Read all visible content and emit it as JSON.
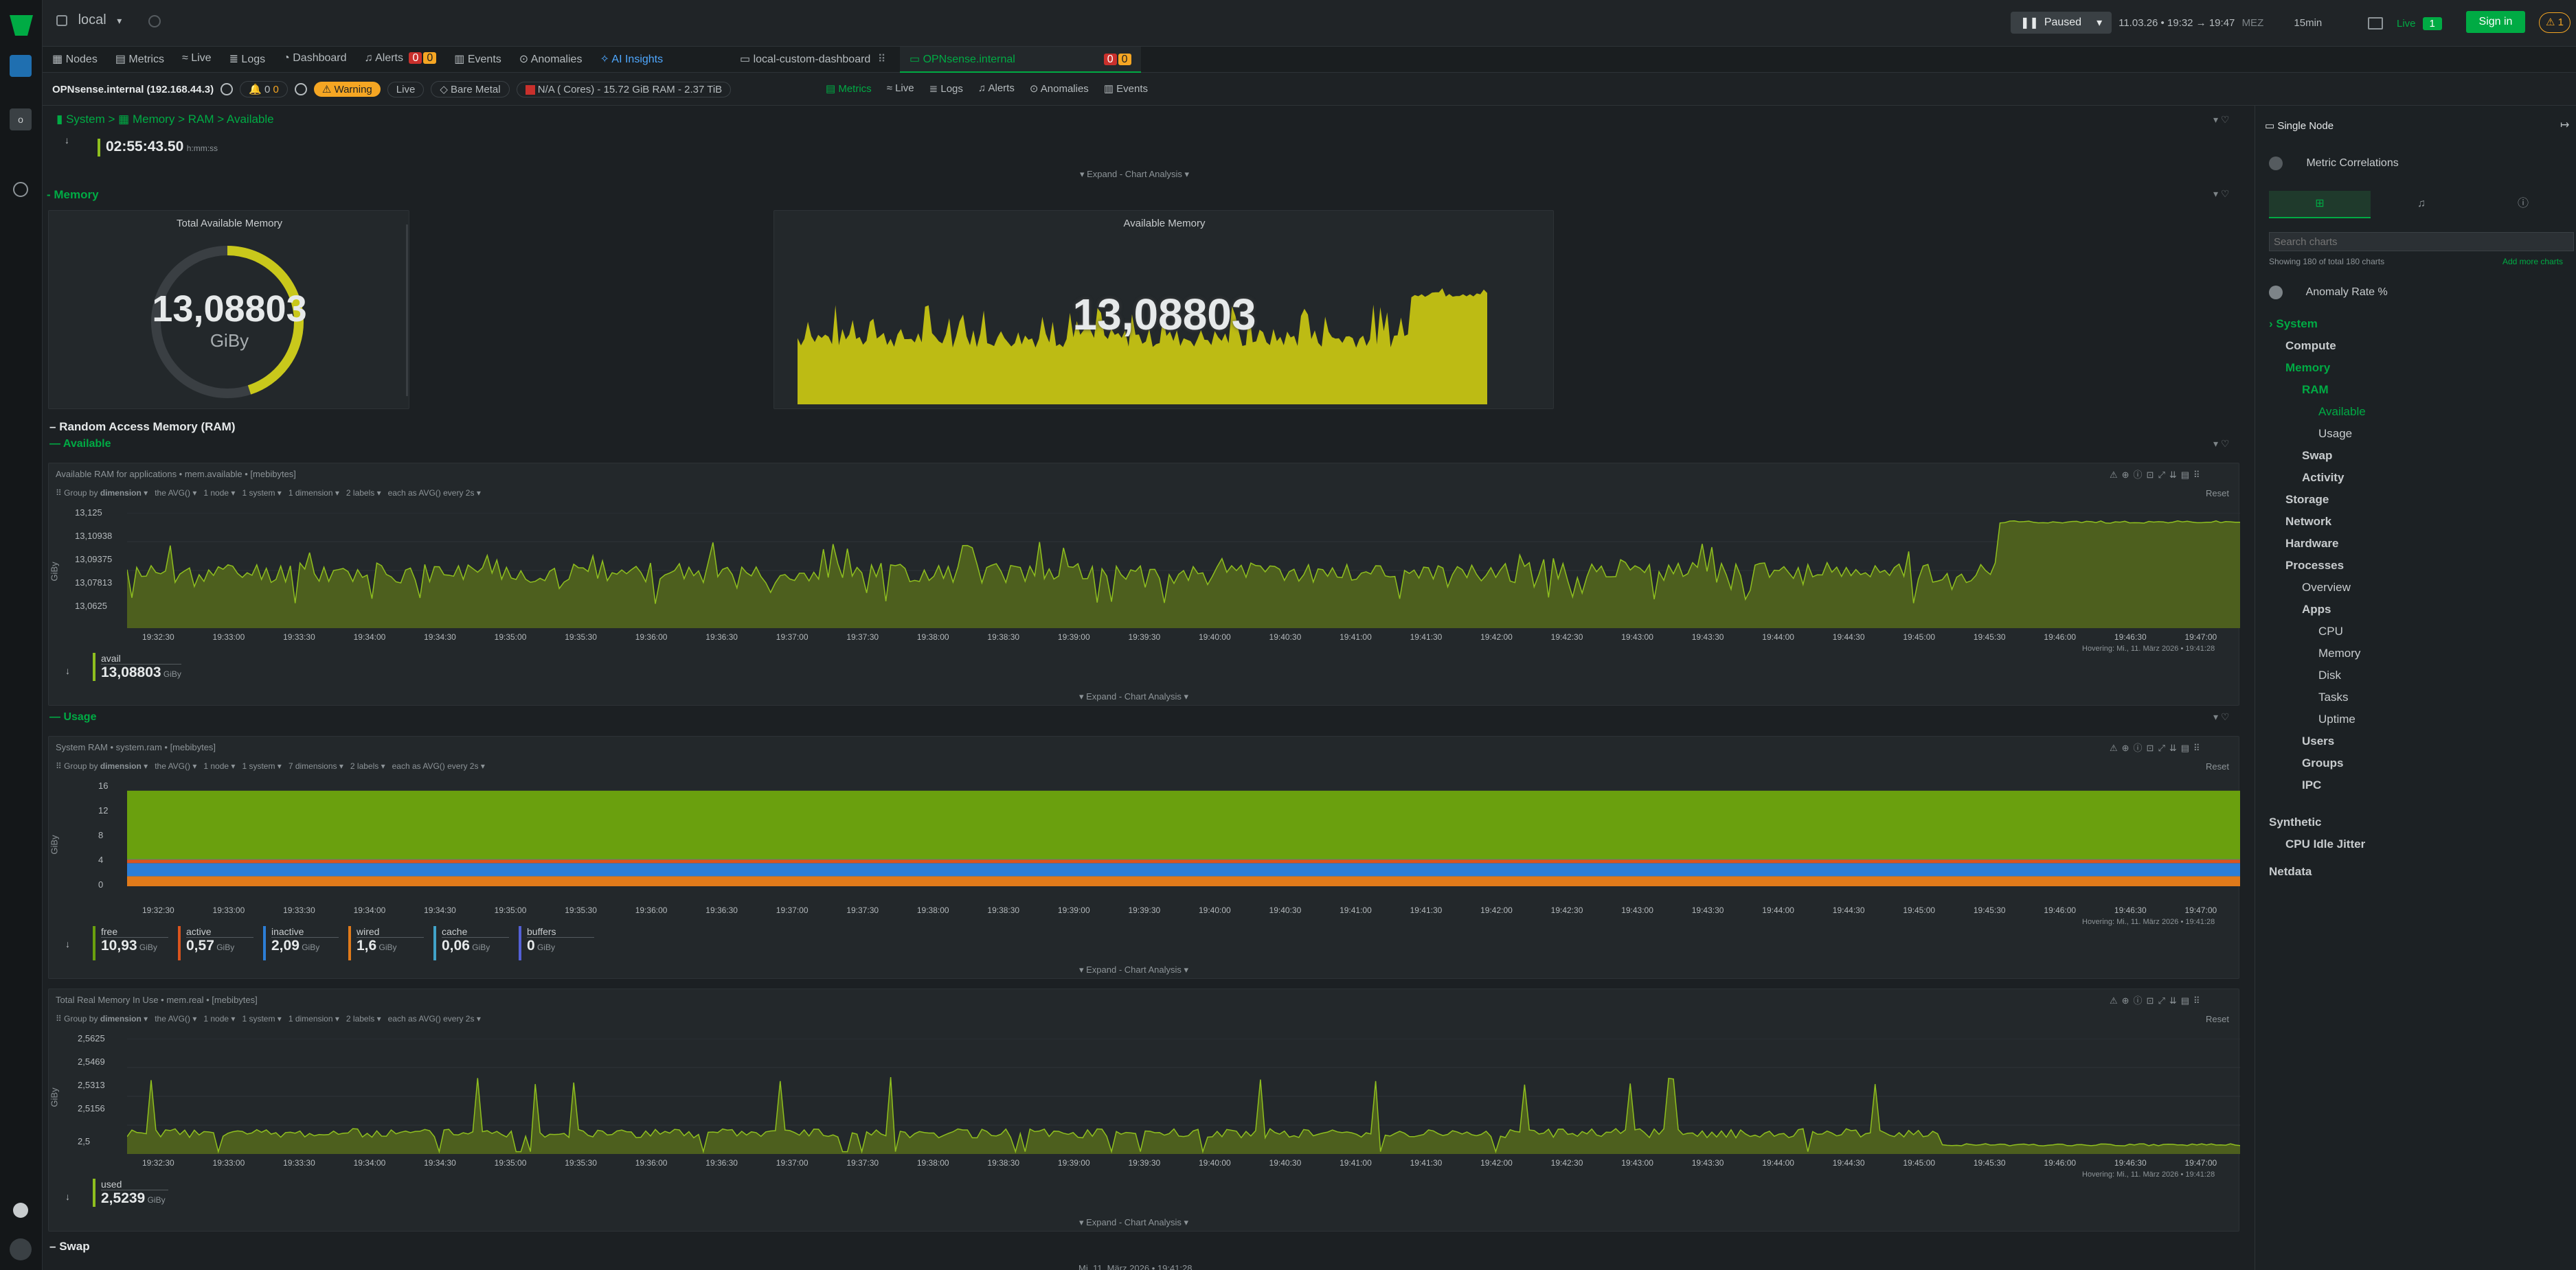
{
  "topbar": {
    "space": "local",
    "nav": [
      "Nodes",
      "Metrics",
      "Live",
      "Logs",
      "Dashboard",
      "Alerts",
      "Events",
      "Anomalies",
      "AI Insights"
    ],
    "alerts_crit": "0",
    "alerts_warn": "0",
    "tabs": [
      "local-custom-dashboard",
      "OPNsense.internal"
    ],
    "tab_crit": "0",
    "tab_warn": "0",
    "paused": "Paused",
    "time_range": "11.03.26 • 19:32 → 19:47",
    "time_zone": "MEZ",
    "duration": "15min",
    "live_label": "Live",
    "live_count": "1",
    "signin": "Sign in",
    "warning_count": "1"
  },
  "nodebar": {
    "node": "OPNsense.internal (192.168.44.3)",
    "crit": "0",
    "warn": "0",
    "warning": "Warning",
    "live": "Live",
    "bare_metal": "Bare Metal",
    "spec": "N/A ( Cores) - 15.72 GiB RAM - 2.37 TiB",
    "subtabs": [
      "Metrics",
      "Live",
      "Logs",
      "Alerts",
      "Anomalies",
      "Events"
    ]
  },
  "breadcrumb": {
    "root": "System",
    "path": "Memory > RAM > Available"
  },
  "top_value": {
    "value": "02:55:43.50",
    "unit": "h:mm:ss"
  },
  "expand": "Expand - Chart Analysis",
  "memory_section": {
    "title": "Memory",
    "gauge_title": "Total Available Memory",
    "gauge_value": "13,08803",
    "gauge_unit": "GiBy",
    "gauge_fraction": 0.45,
    "area_title": "Available Memory",
    "area_value": "13,08803"
  },
  "ram_section": {
    "title": "Random Access Memory (RAM)"
  },
  "available_section": {
    "title": "Available",
    "chart_title": "Available RAM for applications • mem.available • [mebibytes]",
    "controls": [
      "Group by",
      "dimension",
      "the",
      "AVG()",
      "1 node",
      "1 system",
      "1 dimension",
      "2 labels",
      "each as",
      "AVG()",
      "every 2s"
    ],
    "reset": "Reset",
    "ylabel": "GiBy",
    "yticks": [
      "13,125",
      "13,10938",
      "13,09375",
      "13,07813",
      "13,0625"
    ],
    "legend": [
      {
        "name": "avail",
        "value": "13,08803",
        "unit": "GiBy",
        "color": "#8fbf1f"
      }
    ],
    "hover": "Hovering: Mi., 11. März 2026 • 19:41:28"
  },
  "xticks": [
    "19:32:30",
    "19:33:00",
    "19:33:30",
    "19:34:00",
    "19:34:30",
    "19:35:00",
    "19:35:30",
    "19:36:00",
    "19:36:30",
    "19:37:00",
    "19:37:30",
    "19:38:00",
    "19:38:30",
    "19:39:00",
    "19:39:30",
    "19:40:00",
    "19:40:30",
    "19:41:00",
    "19:41:30",
    "19:42:00",
    "19:42:30",
    "19:43:00",
    "19:43:30",
    "19:44:00",
    "19:44:30",
    "19:45:00",
    "19:45:30",
    "19:46:00",
    "19:46:30",
    "19:47:00"
  ],
  "usage_section": {
    "title": "Usage",
    "chart_title": "System RAM • system.ram • [mebibytes]",
    "controls": [
      "Group by",
      "dimension",
      "the",
      "AVG()",
      "1 node",
      "1 system",
      "7 dimensions",
      "2 labels",
      "each as",
      "AVG()",
      "every 2s"
    ],
    "reset": "Reset",
    "ylabel": "GiBy",
    "yticks": [
      "16",
      "12",
      "8",
      "4",
      "0"
    ],
    "legend": [
      {
        "name": "free",
        "value": "10,93",
        "unit": "GiBy",
        "color": "#6aa00e"
      },
      {
        "name": "active",
        "value": "0,57",
        "unit": "GiBy",
        "color": "#d9541e"
      },
      {
        "name": "inactive",
        "value": "2,09",
        "unit": "GiBy",
        "color": "#2c7ed6"
      },
      {
        "name": "wired",
        "value": "1,6",
        "unit": "GiBy",
        "color": "#e07a1a"
      },
      {
        "name": "cache",
        "value": "0,06",
        "unit": "GiBy",
        "color": "#41a3c9"
      },
      {
        "name": "buffers",
        "value": "0",
        "unit": "GiBy",
        "color": "#5460d6"
      }
    ],
    "hover": "Hovering: Mi., 11. März 2026 • 19:41:28"
  },
  "real_section": {
    "chart_title": "Total Real Memory In Use • mem.real • [mebibytes]",
    "controls": [
      "Group by",
      "dimension",
      "the",
      "AVG()",
      "1 node",
      "1 system",
      "1 dimension",
      "2 labels",
      "each as",
      "AVG()",
      "every 2s"
    ],
    "reset": "Reset",
    "ylabel": "GiBy",
    "yticks": [
      "2,5625",
      "2,5469",
      "2,5313",
      "2,5156",
      "2,5"
    ],
    "legend": [
      {
        "name": "used",
        "value": "2,5239",
        "unit": "GiBy",
        "color": "#8fbf1f"
      }
    ],
    "hover": "Hovering: Mi., 11. März 2026 • 19:41:28"
  },
  "swap_section": {
    "title": "Swap"
  },
  "bottom_time": "Mi, 11. März 2026 • 19:41:28",
  "right_panel": {
    "title": "Single Node",
    "metric_correlations": "Metric Correlations",
    "search_placeholder": "Search charts",
    "showing": "Showing 180 of total 180 charts",
    "add_more": "Add more charts",
    "anomaly_rate": "Anomaly Rate %",
    "tree": [
      {
        "label": "System",
        "level": 0,
        "active": true
      },
      {
        "label": "Compute",
        "level": 1
      },
      {
        "label": "Memory",
        "level": 1,
        "active": true
      },
      {
        "label": "RAM",
        "level": 2,
        "active": true
      },
      {
        "label": "Available",
        "level": 3,
        "active": true
      },
      {
        "label": "Usage",
        "level": 3
      },
      {
        "label": "Swap",
        "level": 2
      },
      {
        "label": "Activity",
        "level": 2
      },
      {
        "label": "Storage",
        "level": 1
      },
      {
        "label": "Network",
        "level": 1
      },
      {
        "label": "Hardware",
        "level": 1
      },
      {
        "label": "Processes",
        "level": 1
      },
      {
        "label": "Overview",
        "level": 2
      },
      {
        "label": "Apps",
        "level": 2
      },
      {
        "label": "CPU",
        "level": 3
      },
      {
        "label": "Memory",
        "level": 3
      },
      {
        "label": "Disk",
        "level": 3
      },
      {
        "label": "Tasks",
        "level": 3
      },
      {
        "label": "Uptime",
        "level": 3
      },
      {
        "label": "Users",
        "level": 2
      },
      {
        "label": "Groups",
        "level": 2
      },
      {
        "label": "IPC",
        "level": 2
      },
      {
        "label": "Synthetic",
        "level": 0
      },
      {
        "label": "CPU Idle Jitter",
        "level": 1
      },
      {
        "label": "Netdata",
        "level": 0
      }
    ]
  },
  "colors": {
    "accent": "#00ab44",
    "available_fill": "#4d5f1e",
    "available_line": "#8fbf1f",
    "gauge": "#c9c81b",
    "area": "#bdbb14",
    "warning": "#f5a623",
    "live_green": "#00ab44"
  }
}
